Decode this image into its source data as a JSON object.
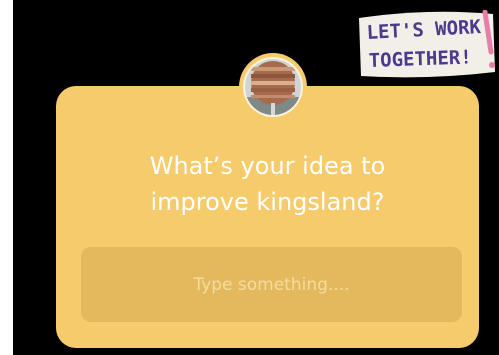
{
  "sticker": {
    "line1": "LET'S WORK",
    "line2": "TOGETHER!"
  },
  "question_card": {
    "question": "What’s your idea to\nimprove kingsland?",
    "input": {
      "placeholder": "Type something....",
      "value": ""
    }
  },
  "colors": {
    "background": "#000000",
    "card": "#f6cb6c",
    "input": "#e4b85d",
    "sticker_bg": "#f2eee8",
    "sticker_text": "#4b3a8c",
    "sticker_accent": "#e87ea8"
  }
}
